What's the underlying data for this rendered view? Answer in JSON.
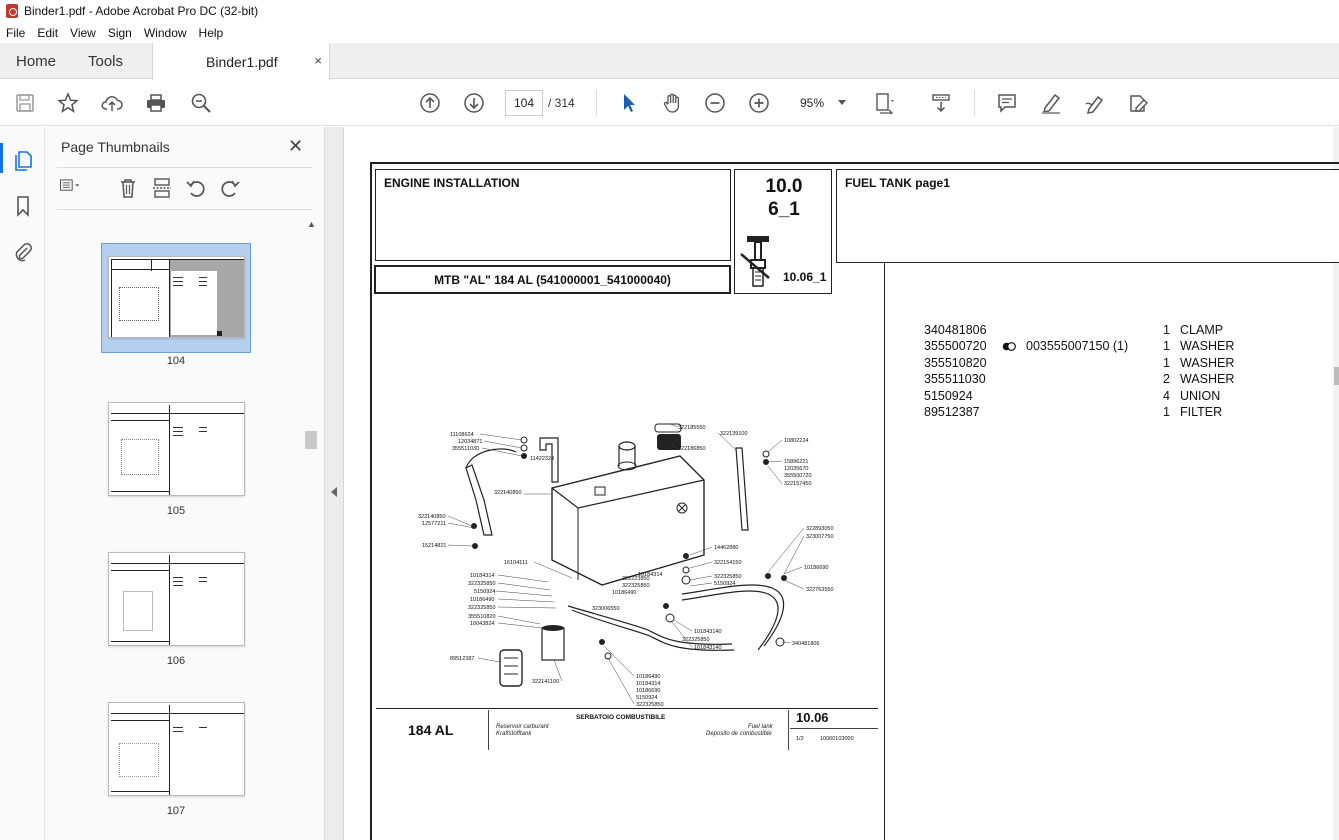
{
  "window": {
    "title": "Binder1.pdf - Adobe Acrobat Pro DC (32-bit)"
  },
  "menu": [
    "File",
    "Edit",
    "View",
    "Sign",
    "Window",
    "Help"
  ],
  "tabs": {
    "home": "Home",
    "tools": "Tools",
    "document": "Binder1.pdf",
    "close": "×"
  },
  "toolbar": {
    "page_current": "104",
    "page_total": "/ 314",
    "zoom": "95%"
  },
  "panel": {
    "title": "Page Thumbnails",
    "close": "✕",
    "thumbnails": [
      {
        "label": "104",
        "selected": true
      },
      {
        "label": "105",
        "selected": false
      },
      {
        "label": "106",
        "selected": false
      },
      {
        "label": "107",
        "selected": false
      }
    ]
  },
  "pdf": {
    "section_title": "ENGINE INSTALLATION",
    "model_line": "MTB \"AL\" 184 AL (541000001_541000040)",
    "section_number": {
      "line1": "10.0",
      "line2": "6_1"
    },
    "icon_ref": "10.06_1",
    "right_title": "FUEL TANK  page1",
    "parts": [
      {
        "code": "340481806",
        "alt_marker": false,
        "alt": "",
        "qty": "1",
        "desc": "CLAMP"
      },
      {
        "code": "355500720",
        "alt_marker": true,
        "alt": "003555007150  (1)",
        "qty": "1",
        "desc": "WASHER"
      },
      {
        "code": "355510820",
        "alt_marker": false,
        "alt": "",
        "qty": "1",
        "desc": "WASHER"
      },
      {
        "code": "355511030",
        "alt_marker": false,
        "alt": "",
        "qty": "2",
        "desc": "WASHER"
      },
      {
        "code": "5150924",
        "alt_marker": false,
        "alt": "",
        "qty": "4",
        "desc": "UNION"
      },
      {
        "code": "89512387",
        "alt_marker": false,
        "alt": "",
        "qty": "1",
        "desc": "FILTER"
      }
    ],
    "diagram_labels": {
      "l1": "11108624",
      "l2": "12034871",
      "l3": "355511030",
      "l4": "11422324",
      "l5": "322140850",
      "l6": "322140850",
      "l7": "12577211",
      "l8": "15214821",
      "l9": "16104111",
      "l10": "10184314",
      "l11": "322325850",
      "l12": "5150924",
      "l13": "10186490",
      "l14": "322325850",
      "l15": "355510820",
      "l16": "10043824",
      "l17": "89512387",
      "l18": "322141100",
      "l19": "323006550",
      "l20": "322185550",
      "l21": "322139100",
      "l22": "322186850",
      "l23": "10802224",
      "l24": "15896221",
      "l25": "12035670",
      "l26": "355500720",
      "l27": "322157450",
      "l28": "322893050",
      "l29": "323007750",
      "l30": "14462880",
      "l31": "322154150",
      "l32": "322223850",
      "l33": "322325850",
      "l34": "10186490",
      "l35": "322325850",
      "l36": "5150924",
      "l37": "10186690",
      "l38": "322763550",
      "l39": "10184314",
      "l40": "101843140",
      "l41": "322325850",
      "l42": "101843140",
      "l43": "340481806",
      "l44": "10186490",
      "l45": "10184314",
      "l46": "10186690",
      "l47": "5150924",
      "l48": "322325850"
    },
    "caption": {
      "model": "184 AL",
      "center_title": "SERBATOIO COMBUSTIBILE",
      "left_line1": "Reservoir carburant",
      "left_line2": "Kraftstofftank",
      "right_line1": "Fuel tank",
      "right_line2": "Deposito de combustible",
      "number": "10.06",
      "fraction": "1/2",
      "code": "10060103000"
    }
  },
  "icons": {
    "app": "acrobat-icon",
    "save": "save-icon",
    "bookmark": "star-icon",
    "share": "upload-cloud-icon",
    "print": "print-icon",
    "find": "zoom-search-icon",
    "prev": "arrow-up-circle-icon",
    "next": "arrow-down-circle-icon",
    "select": "cursor-arrow-icon",
    "hand": "hand-icon",
    "zoom_out": "minus-circle-icon",
    "zoom_in": "plus-circle-icon"
  }
}
